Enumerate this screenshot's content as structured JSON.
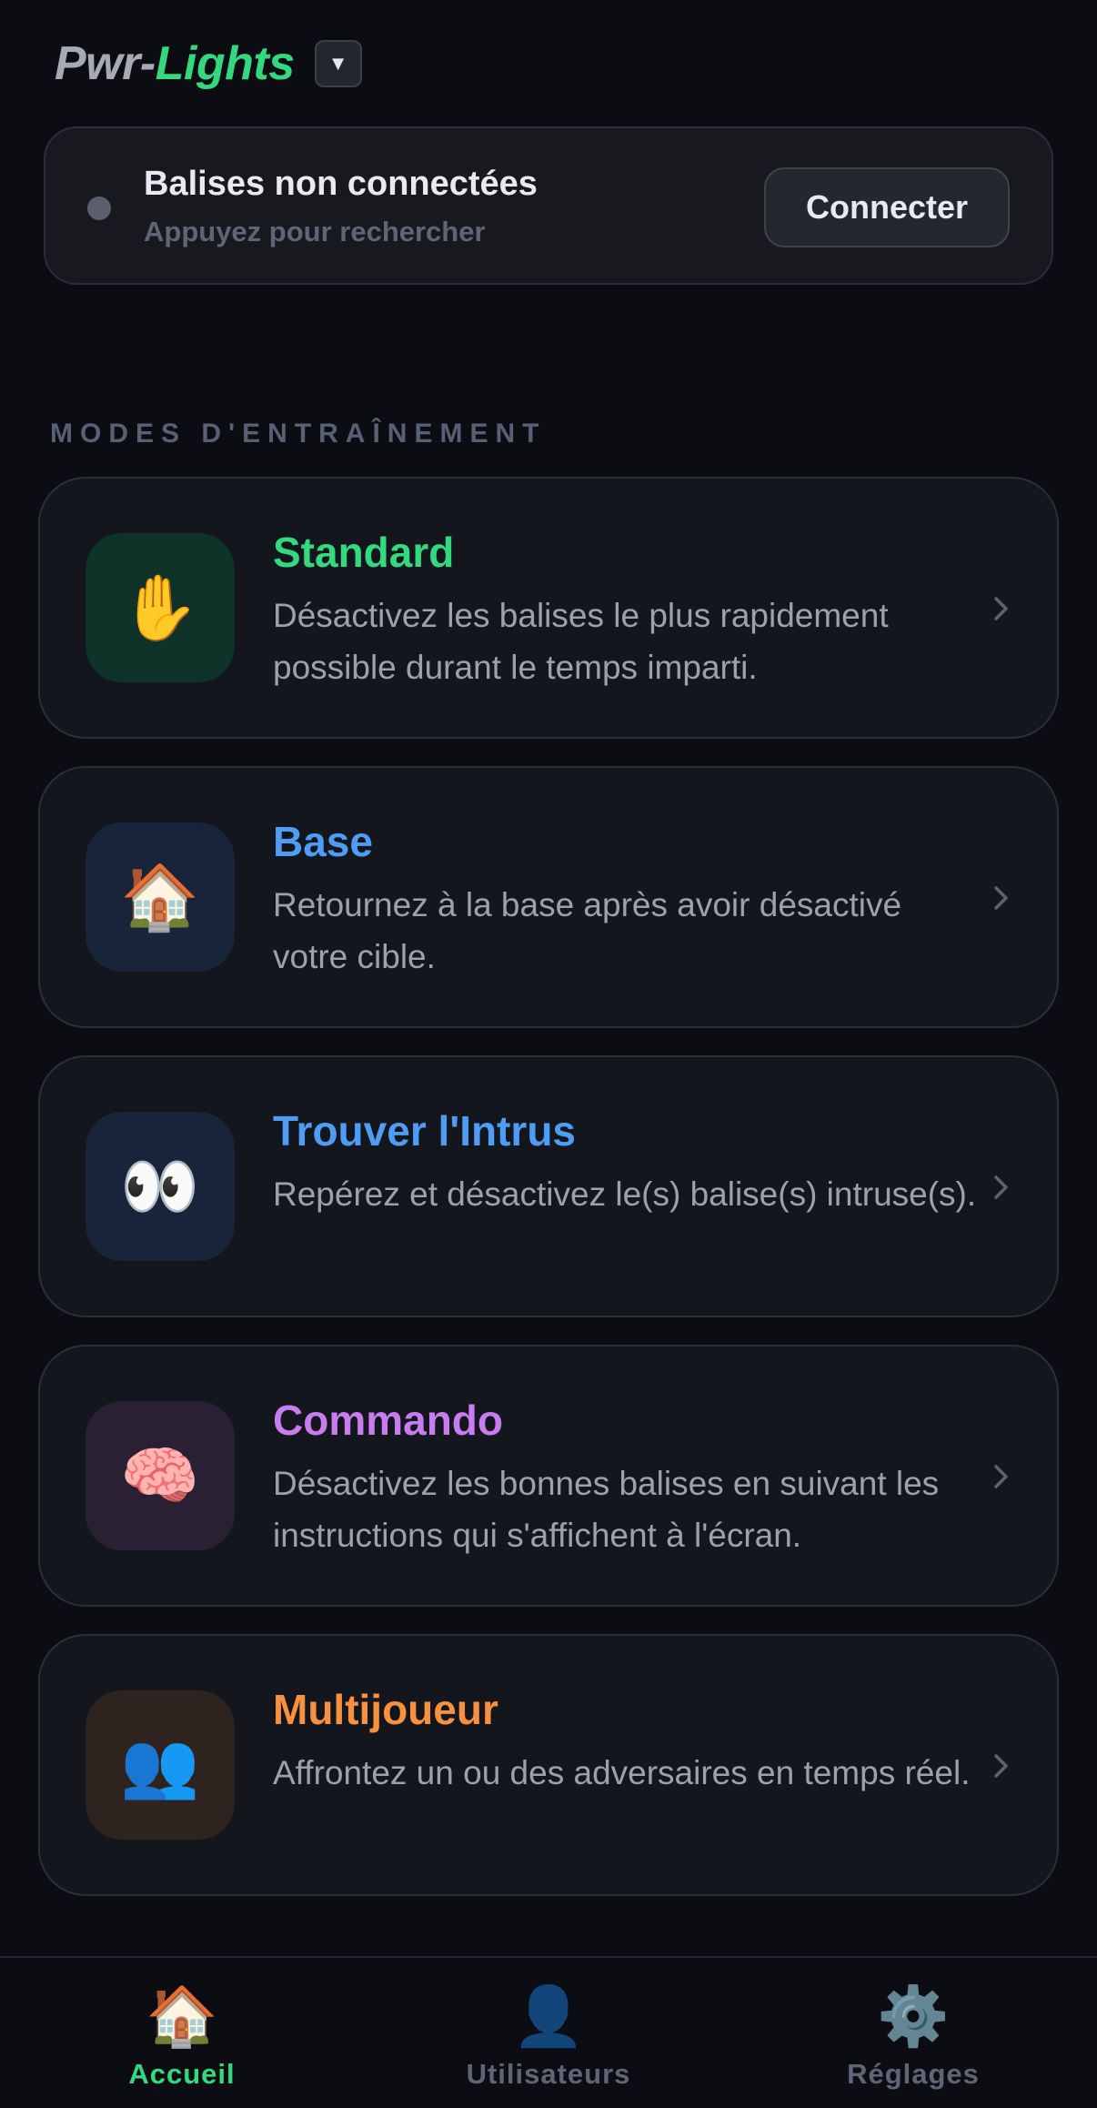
{
  "header": {
    "logo_part1": "Pwr-",
    "logo_part2": "Lights",
    "dropdown_glyph": "▼"
  },
  "connection": {
    "status_color": "#5a5f70",
    "title": "Balises non connectées",
    "subtitle": "Appuyez pour rechercher",
    "button_label": "Connecter"
  },
  "section_title": "MODES D'ENTRAÎNEMENT",
  "modes": [
    {
      "title": "Standard",
      "description": "Désactivez les balises le plus rapidement possible durant le temps imparti.",
      "icon": "✋",
      "icon_name": "raised-hand-icon",
      "title_color": "#34d97f",
      "icon_bg": "#0f3329"
    },
    {
      "title": "Base",
      "description": "Retournez à la base après avoir désactivé votre cible.",
      "icon": "🏠",
      "icon_name": "house-icon",
      "title_color": "#4f9cf5",
      "icon_bg": "#17243a"
    },
    {
      "title": "Trouver l'Intrus",
      "description": "Repérez et désactivez le(s) balise(s) intruse(s).",
      "icon": "👀",
      "icon_name": "eyes-icon",
      "title_color": "#4f9cf5",
      "icon_bg": "#17243a"
    },
    {
      "title": "Commando",
      "description": "Désactivez les bonnes balises en suivant les instructions qui s'affichent à l'écran.",
      "icon": "🧠",
      "icon_name": "brain-icon",
      "title_color": "#c77df0",
      "icon_bg": "#2a2033"
    },
    {
      "title": "Multijoueur",
      "description": "Affrontez un ou des adversaires en temps réel.",
      "icon": "👥",
      "icon_name": "users-icon",
      "title_color": "#f7903f",
      "icon_bg": "#2f2320"
    }
  ],
  "nav": [
    {
      "label": "Accueil",
      "icon": "🏠",
      "icon_name": "home-icon",
      "color": "#34d97f",
      "active": true
    },
    {
      "label": "Utilisateurs",
      "icon": "👤",
      "icon_name": "user-icon",
      "color": "#5f6577",
      "active": false
    },
    {
      "label": "Réglages",
      "icon": "⚙️",
      "icon_name": "gear-icon",
      "color": "#5f6577",
      "active": false
    }
  ]
}
